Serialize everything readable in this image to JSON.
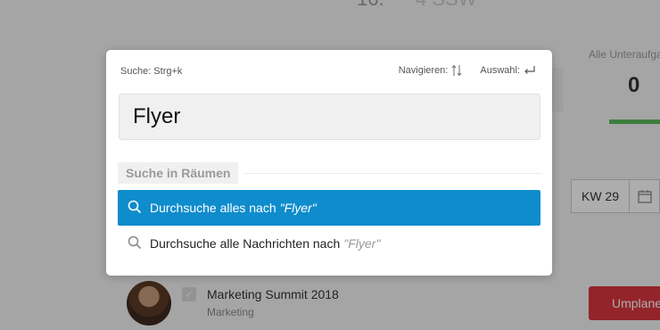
{
  "background": {
    "top_number": "16.",
    "top_number2": "4 SSW",
    "subtasks_label": "Alle Unteraufga",
    "subtasks_count": "0",
    "week_label": "KW 29",
    "event": {
      "title": "Marketing Summit 2018",
      "subtitle": "Marketing",
      "reschedule_label": "Umplane"
    }
  },
  "search_modal": {
    "shortcut_hint": "Suche: Strg+k",
    "navigate_hint": "Navigieren:",
    "select_hint": "Auswahl:",
    "query": "Flyer",
    "section_label": "Suche in Räumen",
    "results": [
      {
        "prefix": "Durchsuche alles nach",
        "term": "\"Flyer\"",
        "active": true
      },
      {
        "prefix": "Durchsuche alle Nachrichten nach",
        "term": "\"Flyer\"",
        "active": false
      }
    ]
  },
  "colors": {
    "accent": "#0f8ccc",
    "danger": "#d9363e",
    "success": "#5cb85c"
  }
}
